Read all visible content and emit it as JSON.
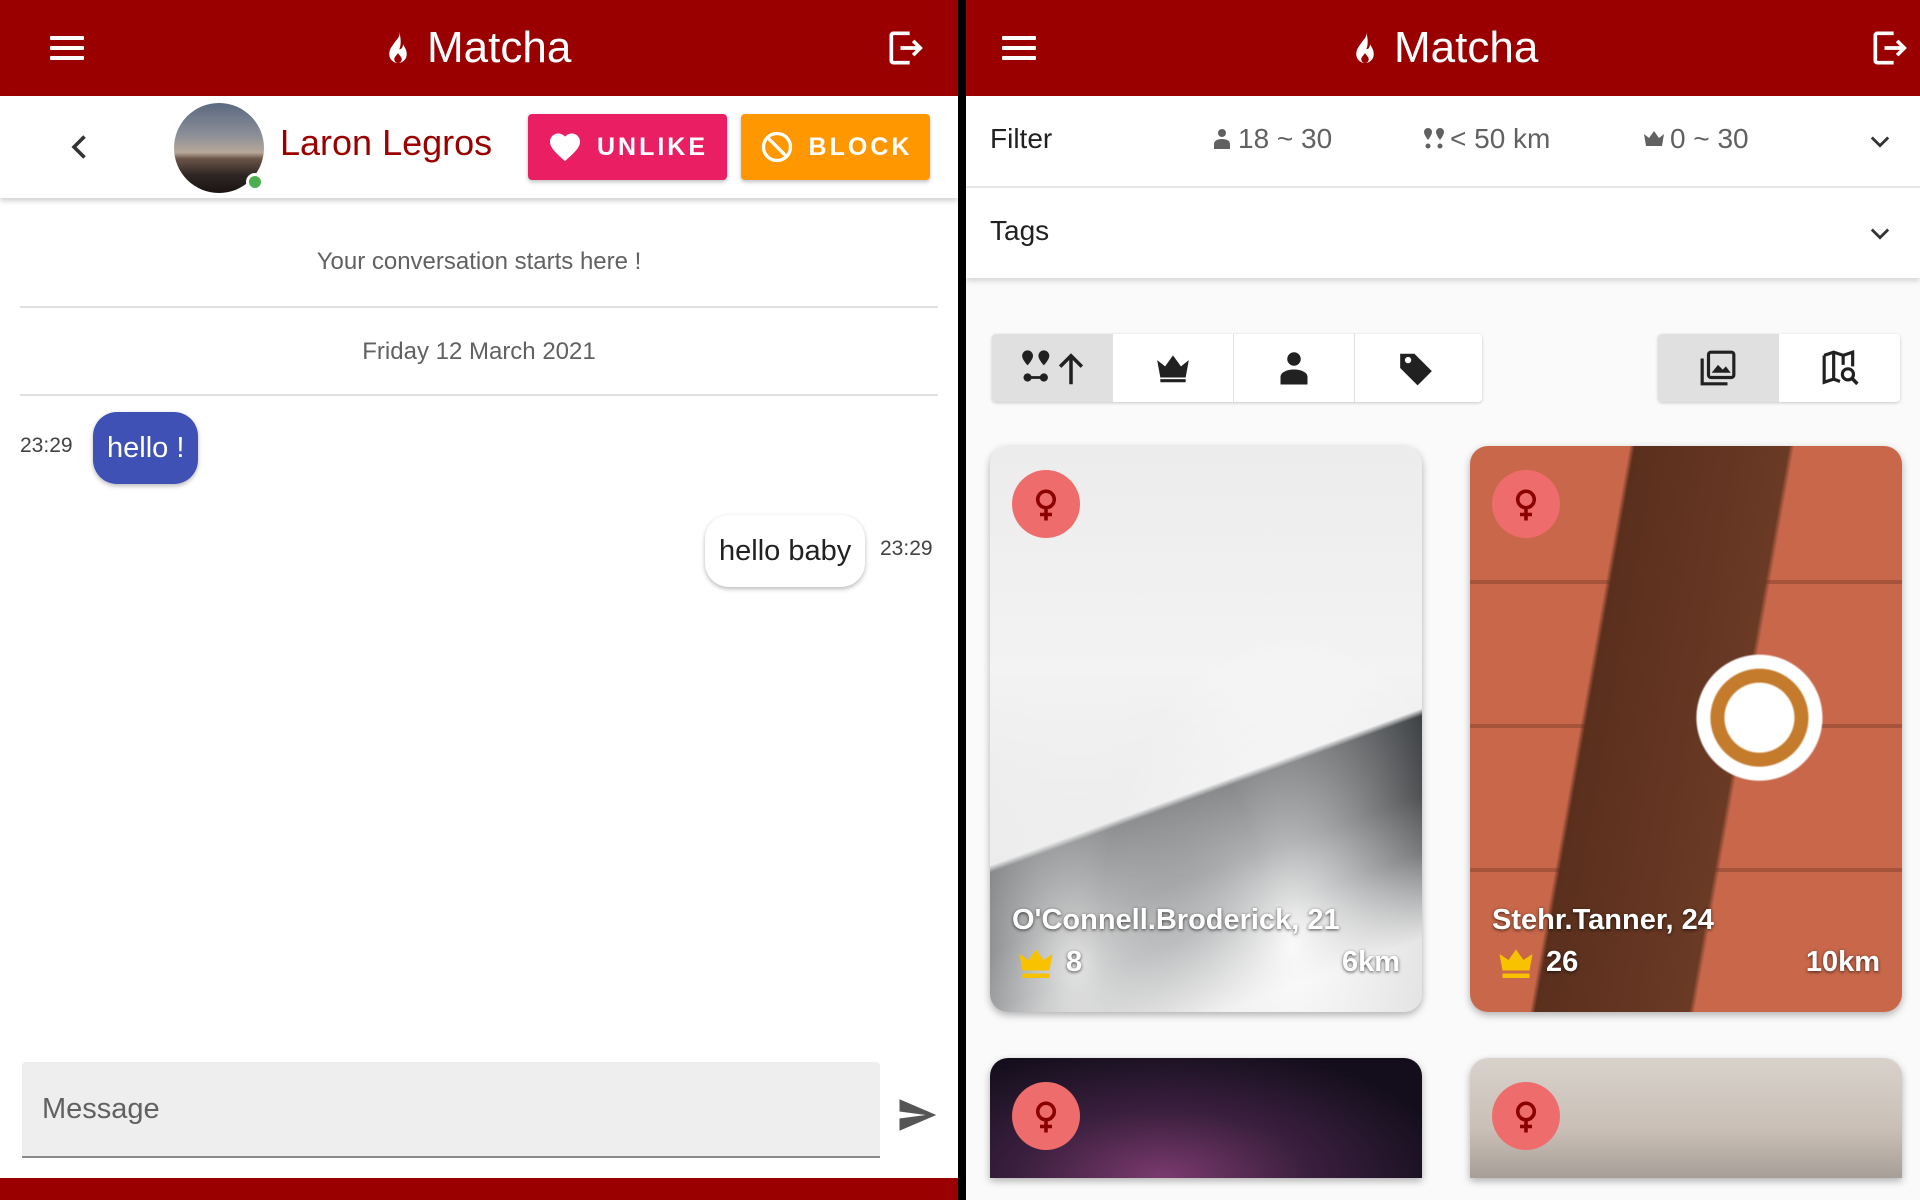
{
  "app": {
    "title": "Matcha",
    "colors": {
      "primary": "#9a0000",
      "unlike": "#e91e63",
      "block": "#ff9800",
      "online": "#4caf50",
      "bubble_in": "#3f51b5",
      "gender_badge": "#ef6c6c",
      "score_crown": "#f9c200"
    }
  },
  "chat": {
    "partner_name": "Laron Legros",
    "online": true,
    "unlike_label": "UNLIKE",
    "block_label": "BLOCK",
    "start_text": "Your conversation starts here !",
    "date_label": "Friday 12 March 2021",
    "messages": [
      {
        "direction": "in",
        "text": "hello !",
        "time": "23:29"
      },
      {
        "direction": "out",
        "text": "hello baby",
        "time": "23:29"
      }
    ],
    "input_placeholder": "Message"
  },
  "filters": {
    "filter_label": "Filter",
    "age_range": "18 ~ 30",
    "distance": "< 50 km",
    "score_range": "0 ~ 30",
    "tags_label": "Tags"
  },
  "sort_options": [
    {
      "icon": "distance-sort-ascending-icon",
      "active": true
    },
    {
      "icon": "crown-sort-icon",
      "active": false
    },
    {
      "icon": "age-sort-icon",
      "active": false
    },
    {
      "icon": "tag-sort-icon",
      "active": false
    }
  ],
  "view_modes": [
    {
      "icon": "gallery-view-icon",
      "active": true
    },
    {
      "icon": "map-search-view-icon",
      "active": false
    }
  ],
  "profiles": [
    {
      "name": "O'Connell.Broderick, 21",
      "score": "8",
      "distance": "6km",
      "gender": "female"
    },
    {
      "name": "Stehr.Tanner, 24",
      "score": "26",
      "distance": "10km",
      "gender": "female"
    },
    {
      "gender": "female"
    },
    {
      "gender": "female"
    }
  ]
}
